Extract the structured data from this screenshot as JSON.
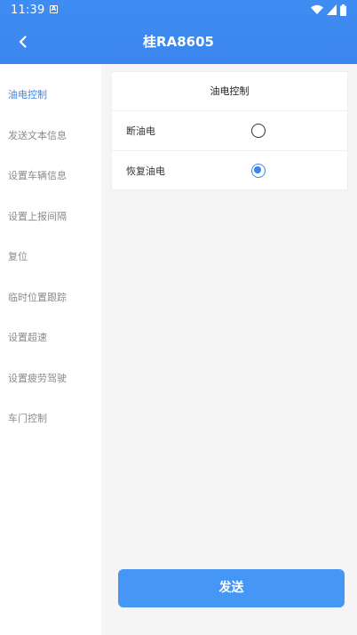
{
  "status_bar": {
    "time": "11:39",
    "notif_icon": "a-box-icon",
    "icons": [
      "wifi-icon",
      "signal-icon",
      "battery-icon"
    ]
  },
  "app_bar": {
    "back_icon": "chevron-left-icon",
    "title": "桂RA8605"
  },
  "sidebar": {
    "items": [
      {
        "label": "油电控制",
        "active": true
      },
      {
        "label": "发送文本信息",
        "active": false
      },
      {
        "label": "设置车辆信息",
        "active": false
      },
      {
        "label": "设置上报间隔",
        "active": false
      },
      {
        "label": "复位",
        "active": false
      },
      {
        "label": "临时位置跟踪",
        "active": false
      },
      {
        "label": "设置超速",
        "active": false
      },
      {
        "label": "设置疲劳驾驶",
        "active": false
      },
      {
        "label": "车门控制",
        "active": false
      }
    ]
  },
  "panel": {
    "header": "油电控制",
    "options": [
      {
        "label": "断油电",
        "selected": false
      },
      {
        "label": "恢复油电",
        "selected": true
      }
    ]
  },
  "send_button": {
    "label": "发送"
  },
  "colors": {
    "accent": "#3a86ee",
    "button": "#4596f5",
    "background": "#f5f5f5"
  }
}
